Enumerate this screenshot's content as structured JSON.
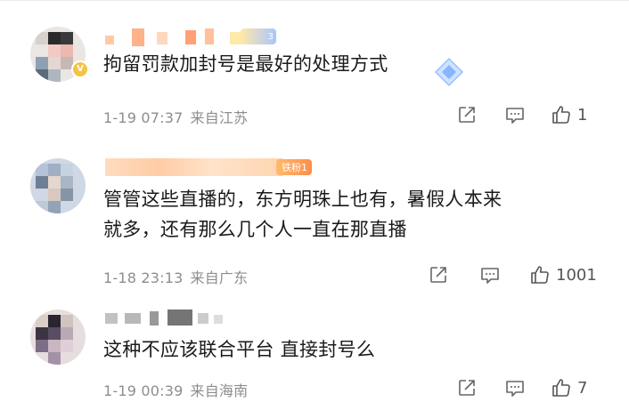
{
  "comments": [
    {
      "text": "拘留罚款加封号是最好的处理方式",
      "badge": "3",
      "time": "1-19 07:37",
      "location": "来自江苏",
      "likes": "1"
    },
    {
      "text_line1": "管管这些直播的，东方明珠上也有，暑假人本来",
      "text_line2": "就多，还有那么几个人一直在那直播",
      "badge": "铁粉1",
      "time": "1-18 23:13",
      "location": "来自广东",
      "likes": "1001"
    },
    {
      "text": "这种不应该联合平台 直接封号么",
      "time": "1-19 00:39",
      "location": "来自海南",
      "likes": "7"
    }
  ],
  "icons": [
    "share-icon",
    "comment-icon",
    "like-icon",
    "verified-badge-icon",
    "diamond-icon"
  ],
  "colors": {
    "meta": "#8d8d8d",
    "text": "#1a1a1a",
    "fan_badge": "#ff9a4f",
    "verified": "#f6c244"
  }
}
